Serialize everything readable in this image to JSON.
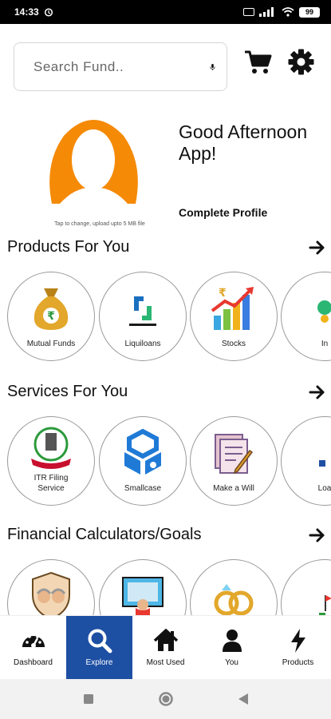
{
  "status_bar": {
    "time": "14:33",
    "battery": "99"
  },
  "search": {
    "placeholder": "Search Fund.."
  },
  "profile": {
    "upload_hint": "Tap to change, upload upto 5 MB file",
    "greeting": "Good Afternoon App!",
    "complete_profile_label": "Complete Profile"
  },
  "sections": {
    "products": {
      "title": "Products For You",
      "items": [
        {
          "label": "Mutual Funds",
          "icon": "money-bag-icon"
        },
        {
          "label": "Liquiloans",
          "icon": "liquiloans-logo-icon"
        },
        {
          "label": "Stocks",
          "icon": "stock-chart-icon"
        },
        {
          "label": "In",
          "icon": "insurance-icon"
        }
      ]
    },
    "services": {
      "title": "Services For You",
      "items": [
        {
          "label": "ITR Filing Service",
          "icon": "income-tax-emblem-icon"
        },
        {
          "label": "Smallcase",
          "icon": "smallcase-logo-icon"
        },
        {
          "label": "Make a Will",
          "icon": "will-document-icon"
        },
        {
          "label": "Loa",
          "icon": "loan-icon"
        }
      ]
    },
    "calculators": {
      "title": "Financial Calculators/Goals",
      "items": [
        {
          "label": "",
          "icon": "retirement-couple-icon"
        },
        {
          "label": "",
          "icon": "education-icon"
        },
        {
          "label": "",
          "icon": "wedding-rings-icon"
        },
        {
          "label": "",
          "icon": "house-icon"
        }
      ]
    }
  },
  "bottom_nav": [
    {
      "label": "Dashboard",
      "icon": "speedometer-icon",
      "active": false
    },
    {
      "label": "Explore",
      "icon": "search-icon",
      "active": true
    },
    {
      "label": "Most Used",
      "icon": "home-icon",
      "active": false
    },
    {
      "label": "You",
      "icon": "person-icon",
      "active": false
    },
    {
      "label": "Products",
      "icon": "lightning-icon",
      "active": false
    }
  ],
  "colors": {
    "accent": "#1d4fa3",
    "avatar": "#f58a07",
    "border": "#9a9a9a"
  }
}
